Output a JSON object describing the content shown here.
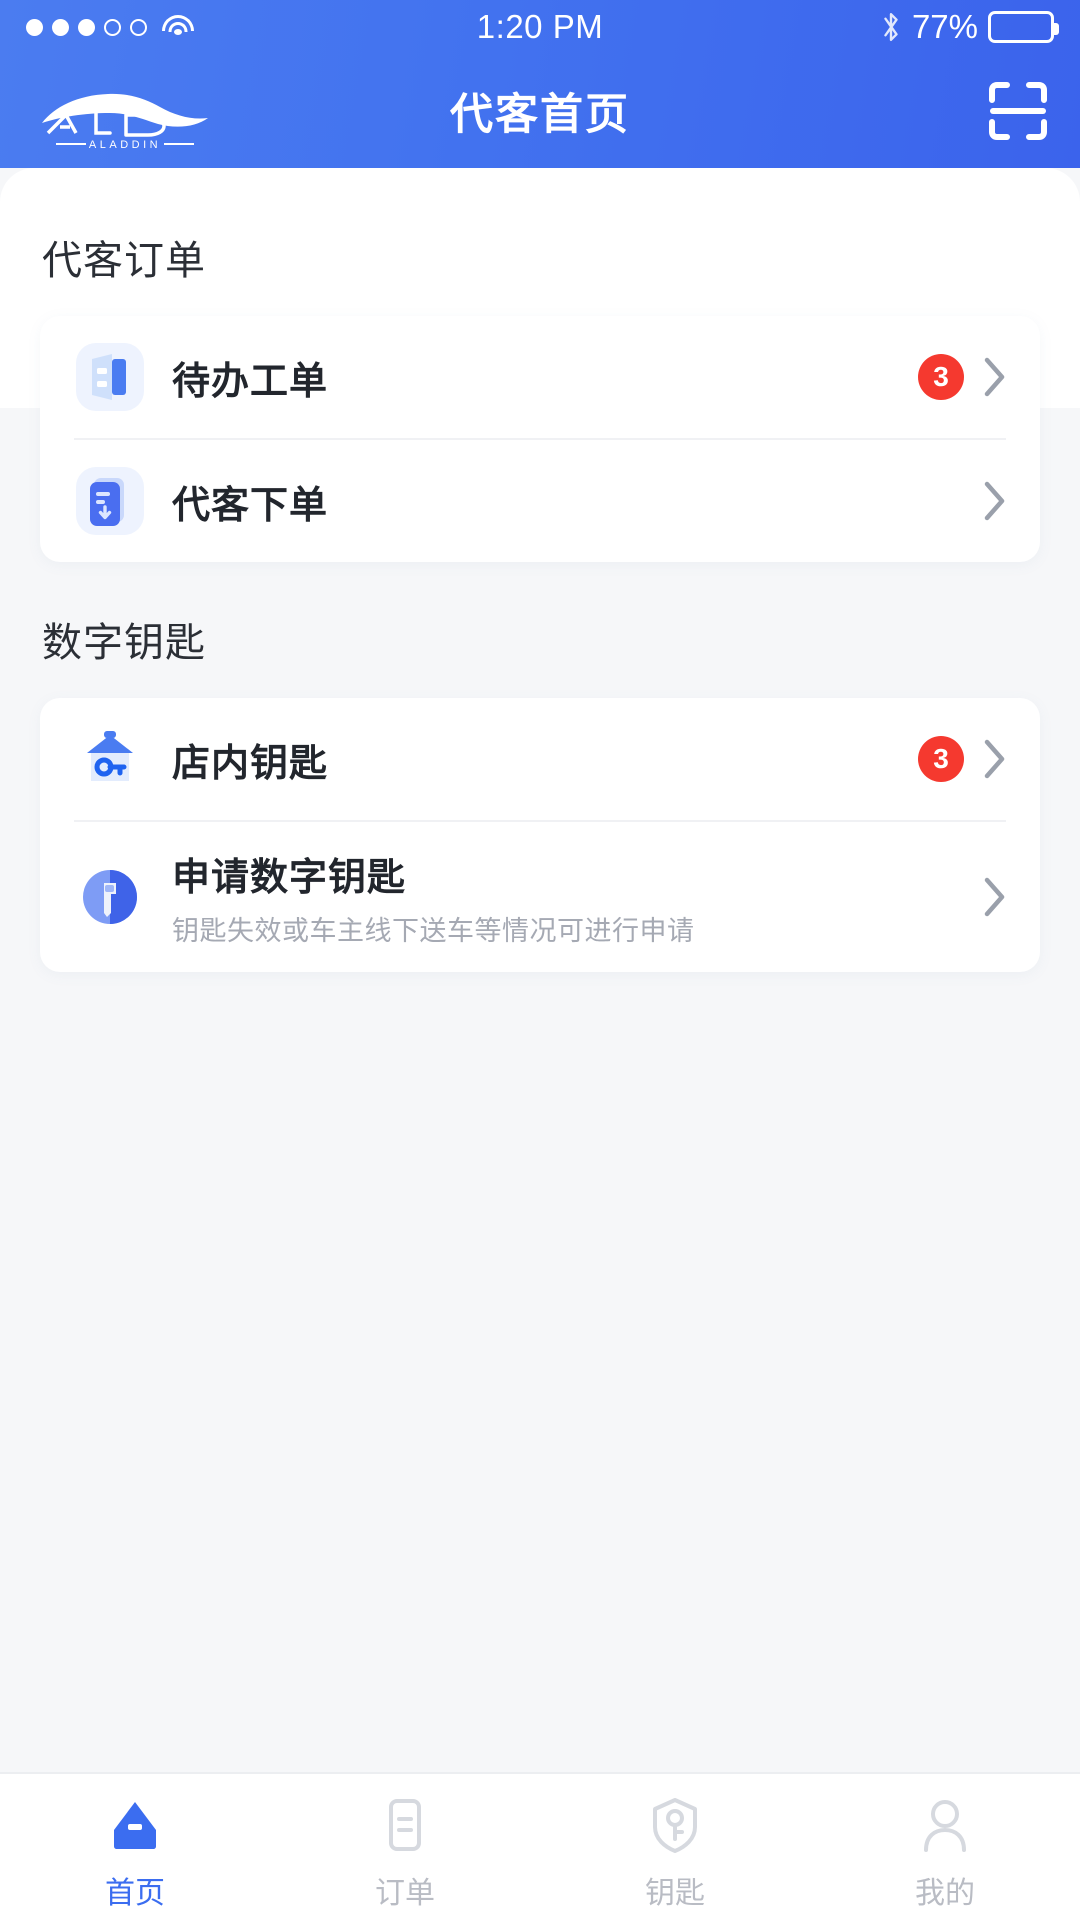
{
  "status_bar": {
    "signal_dots_filled": 3,
    "signal_dots_total": 5,
    "wifi_icon": "wifi-icon",
    "time": "1:20 PM",
    "bluetooth_icon": "bluetooth-icon",
    "battery_percent": "77%",
    "battery_level": 77
  },
  "header": {
    "logo_icon": "aladdin-car-logo",
    "logo_wordmark": "ALADDIN",
    "title": "代客首页",
    "scan_icon": "scan-qr-icon",
    "gradient_start": "#4b7cf0",
    "gradient_end": "#3b63ec"
  },
  "sections": [
    {
      "title": "代客订单",
      "items": [
        {
          "icon": "work-order-icon",
          "title": "待办工单",
          "subtitle": "",
          "badge": "3",
          "chevron_icon": "chevron-right-icon"
        },
        {
          "icon": "place-order-icon",
          "title": "代客下单",
          "subtitle": "",
          "badge": "",
          "chevron_icon": "chevron-right-icon"
        }
      ]
    },
    {
      "title": "数字钥匙",
      "items": [
        {
          "icon": "store-key-icon",
          "title": "店内钥匙",
          "subtitle": "",
          "badge": "3",
          "chevron_icon": "chevron-right-icon"
        },
        {
          "icon": "apply-key-icon",
          "title": "申请数字钥匙",
          "subtitle": "钥匙失效或车主线下送车等情况可进行申请",
          "badge": "",
          "chevron_icon": "chevron-right-icon"
        }
      ]
    }
  ],
  "tabbar": {
    "active_color": "#3b6df0",
    "inactive_color": "#b9bcc4",
    "tabs": [
      {
        "label": "首页",
        "icon": "home-icon",
        "active": true
      },
      {
        "label": "订单",
        "icon": "order-list-icon",
        "active": false
      },
      {
        "label": "钥匙",
        "icon": "key-shield-icon",
        "active": false
      },
      {
        "label": "我的",
        "icon": "profile-person-icon",
        "active": false
      }
    ]
  },
  "colors": {
    "badge_red": "#f5392f",
    "page_background": "#f6f7f9",
    "card_background": "#ffffff"
  }
}
